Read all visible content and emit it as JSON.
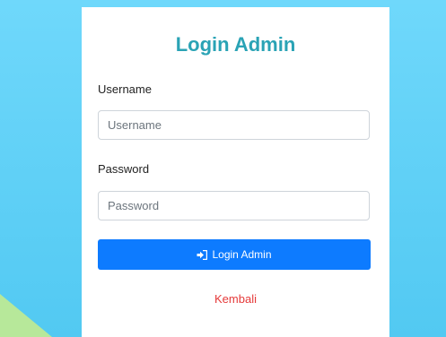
{
  "login": {
    "title": "Login Admin",
    "username_label": "Username",
    "username_placeholder": "Username",
    "password_label": "Password",
    "password_placeholder": "Password",
    "submit_label": "Login Admin",
    "submit_icon": "sign-in-icon",
    "back_link": "Kembali"
  },
  "colors": {
    "background": "#5fd3f5",
    "title": "#2aa3b5",
    "button": "#0d7bff",
    "back_link": "#e53a3a",
    "accent_corner": "#b7e89a"
  }
}
